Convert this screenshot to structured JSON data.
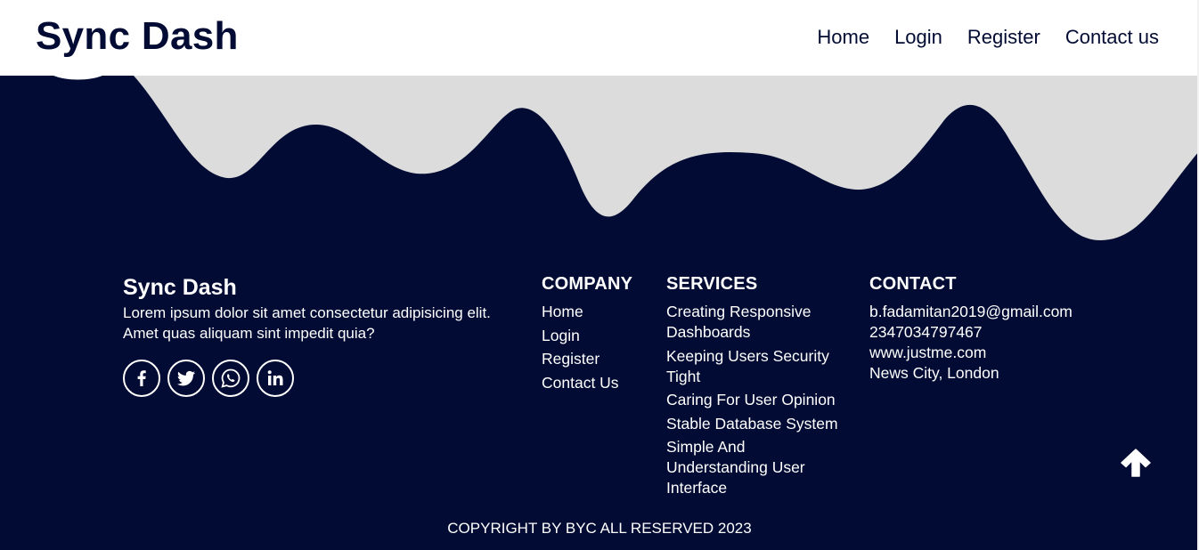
{
  "navbar": {
    "brand": "Sync Dash",
    "links": [
      "Home",
      "Login",
      "Register",
      "Contact us"
    ]
  },
  "footer": {
    "about": {
      "brand": "Sync Dash",
      "text": "Lorem ipsum dolor sit amet consectetur adipisicing elit. Amet quas aliquam sint impedit quia?"
    },
    "socials": [
      "facebook-icon",
      "twitter-icon",
      "whatsapp-icon",
      "linkedin-icon"
    ],
    "company": {
      "heading": "COMPANY",
      "links": [
        "Home",
        "Login",
        "Register",
        "Contact Us"
      ]
    },
    "services": {
      "heading": "SERVICES",
      "items": [
        "Creating Responsive Dashboards",
        "Keeping Users Security Tight",
        "Caring For User Opinion",
        "Stable Database System",
        "Simple And Understanding User Interface"
      ]
    },
    "contact": {
      "heading": "CONTACT",
      "email": "b.fadamitan2019@gmail.com",
      "phone": "2347034797467",
      "website": "www.justme.com",
      "address": "News City, London"
    },
    "copyright": "COPYRIGHT BY BYC ALL RESERVED 2023"
  },
  "colors": {
    "navy": "#020b33",
    "wave": "#dcdcdc",
    "white": "#ffffff"
  }
}
